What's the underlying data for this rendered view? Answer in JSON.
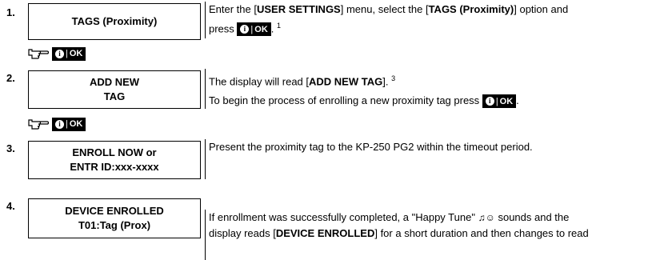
{
  "key_label": "OK",
  "key_icon": "info-circle-icon",
  "steps": [
    {
      "num": "1.",
      "box_lines": [
        "TAGS (Proximity)"
      ],
      "desc": {
        "p1": "Enter the [",
        "b1": "USER SETTINGS",
        "p2": "] menu, select the [",
        "b2": "TAGS (Proximity)",
        "p3": "] option and",
        "p4": "press",
        "p5": ".",
        "sup": "1"
      }
    },
    {
      "num": "2.",
      "box_lines": [
        "ADD NEW",
        "TAG"
      ],
      "desc": {
        "p1": "The display will read [",
        "b1": "ADD NEW TAG",
        "p2": "].",
        "sup": "3",
        "line2": "To begin the process of enrolling a new proximity tag press",
        "p3": "."
      }
    },
    {
      "num": "3.",
      "box_lines": [
        "ENROLL NOW or",
        "ENTR ID:xxx-xxxx"
      ],
      "desc": {
        "text": "Present the proximity tag to the KP-250 PG2 within the timeout period."
      }
    },
    {
      "num": "4.",
      "box_lines": [
        "DEVICE ENROLLED",
        "T01:Tag (Prox)"
      ],
      "desc": {
        "p1": "If enrollment was successfully completed, a \"Happy Tune\"",
        "tune": "♫☺",
        "p2": "sounds and the",
        "p3": "display reads [",
        "b1": "DEVICE ENROLLED",
        "p4": "] for a short duration and then changes to read"
      }
    }
  ]
}
